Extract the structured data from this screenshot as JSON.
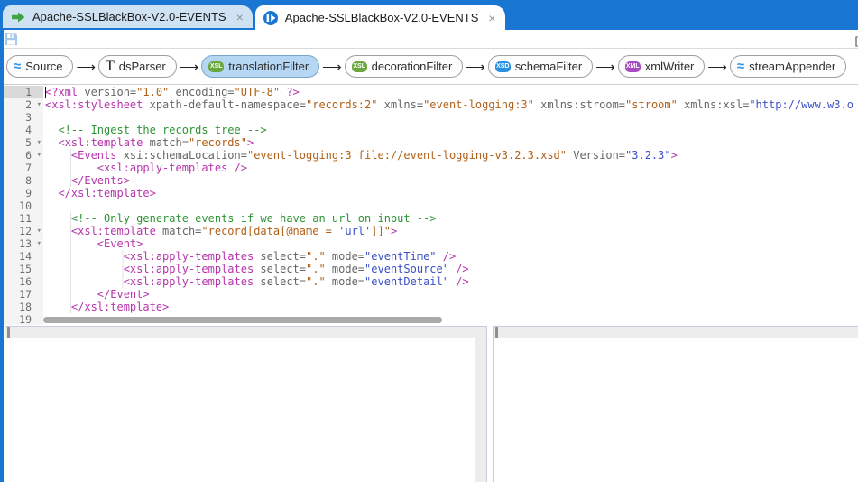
{
  "window": {
    "corner_text": "[-"
  },
  "colors": {
    "titlebar": "#1976d2",
    "tab_inactive_bg": "#cfe2f4",
    "selected_chip_bg": "#b5d7f3",
    "wave_icon": "#2b95e8",
    "xsl_badge": "#6aa83f",
    "xsd_badge": "#2b90e0",
    "xml_badge": "#a94bc0",
    "code_tag": "#b734ad",
    "code_attr": "#666666",
    "code_val": "#b06018",
    "code_str": "#3b50c8",
    "code_comment": "#2f9335"
  },
  "tabs": [
    {
      "label": "Apache-SSLBlackBox-V2.0-EVENTS",
      "icon": "pipeline-arrow-icon",
      "close_glyph": "×",
      "active": false
    },
    {
      "label": "Apache-SSLBlackBox-V2.0-EVENTS",
      "icon": "xslt-doc-icon",
      "close_glyph": "×",
      "active": true
    }
  ],
  "toolbar": {
    "save_icon": "save-icon"
  },
  "pipeline": {
    "arrow_glyph": "⟶",
    "icon_badges": {
      "xsl": "XSL",
      "xsd": "XSD",
      "xml": "XML",
      "stream": "≈",
      "text": "T"
    },
    "elements": [
      {
        "label": "Source",
        "icon": "stream",
        "selected": false
      },
      {
        "label": "dsParser",
        "icon": "text",
        "selected": false
      },
      {
        "label": "translationFilter",
        "icon": "xsl",
        "selected": true
      },
      {
        "label": "decorationFilter",
        "icon": "xsl",
        "selected": false
      },
      {
        "label": "schemaFilter",
        "icon": "xsd",
        "selected": false
      },
      {
        "label": "xmlWriter",
        "icon": "xml",
        "selected": false
      },
      {
        "label": "streamAppender",
        "icon": "stream",
        "selected": false
      }
    ]
  },
  "editor": {
    "active_line": 1,
    "fold_glyph": "▾",
    "folded_lines": [
      2,
      5,
      6,
      12,
      13
    ],
    "lines": [
      {
        "n": 1,
        "seg": [
          [
            "tag",
            "<?xml"
          ],
          [
            "attr",
            " version="
          ],
          [
            "val",
            "\"1.0\""
          ],
          [
            "attr",
            " encoding="
          ],
          [
            "val",
            "\"UTF-8\""
          ],
          [
            "tag",
            " ?>"
          ]
        ]
      },
      {
        "n": 2,
        "seg": [
          [
            "tag",
            "<xsl:stylesheet"
          ],
          [
            "attr",
            " xpath-default-namespace="
          ],
          [
            "val",
            "\"records:2\""
          ],
          [
            "attr",
            " xmlns="
          ],
          [
            "val",
            "\"event-logging:3\""
          ],
          [
            "attr",
            " xmlns:stroom="
          ],
          [
            "val",
            "\"stroom\""
          ],
          [
            "attr",
            " xmlns:xsl="
          ],
          [
            "str",
            "\"http://www.w3.o"
          ]
        ]
      },
      {
        "n": 3,
        "seg": []
      },
      {
        "n": 4,
        "seg": [
          [
            "ws",
            "  "
          ],
          [
            "com",
            "<!-- Ingest the records tree -->"
          ]
        ]
      },
      {
        "n": 5,
        "seg": [
          [
            "ws",
            "  "
          ],
          [
            "tag",
            "<xsl:template"
          ],
          [
            "attr",
            " match="
          ],
          [
            "val",
            "\"records\""
          ],
          [
            "tag",
            ">"
          ]
        ]
      },
      {
        "n": 6,
        "seg": [
          [
            "ws",
            "    "
          ],
          [
            "tag",
            "<Events"
          ],
          [
            "attr",
            " xsi:schemaLocation="
          ],
          [
            "val",
            "\"event-logging:3 file://event-logging-v3.2.3.xsd\""
          ],
          [
            "attr",
            " Version="
          ],
          [
            "str",
            "\"3.2.3\""
          ],
          [
            "tag",
            ">"
          ]
        ]
      },
      {
        "n": 7,
        "seg": [
          [
            "ws",
            "        "
          ],
          [
            "tag",
            "<xsl:apply-templates />"
          ]
        ]
      },
      {
        "n": 8,
        "seg": [
          [
            "ws",
            "    "
          ],
          [
            "tag",
            "</Events>"
          ]
        ]
      },
      {
        "n": 9,
        "seg": [
          [
            "ws",
            "  "
          ],
          [
            "tag",
            "</xsl:template>"
          ]
        ]
      },
      {
        "n": 10,
        "seg": []
      },
      {
        "n": 11,
        "seg": [
          [
            "ws",
            "    "
          ],
          [
            "com",
            "<!-- Only generate events if we have an url on input -->"
          ]
        ]
      },
      {
        "n": 12,
        "seg": [
          [
            "ws",
            "    "
          ],
          [
            "tag",
            "<xsl:template"
          ],
          [
            "attr",
            " match="
          ],
          [
            "val",
            "\"record[data[@name = "
          ],
          [
            "str",
            "'url'"
          ],
          [
            "val",
            "]]\""
          ],
          [
            "tag",
            ">"
          ]
        ]
      },
      {
        "n": 13,
        "seg": [
          [
            "ws",
            "        "
          ],
          [
            "tag",
            "<Event>"
          ]
        ]
      },
      {
        "n": 14,
        "seg": [
          [
            "ws",
            "            "
          ],
          [
            "tag",
            "<xsl:apply-templates"
          ],
          [
            "attr",
            " select="
          ],
          [
            "val",
            "\".\""
          ],
          [
            "attr",
            " mode="
          ],
          [
            "str",
            "\"eventTime\""
          ],
          [
            "tag",
            " />"
          ]
        ]
      },
      {
        "n": 15,
        "seg": [
          [
            "ws",
            "            "
          ],
          [
            "tag",
            "<xsl:apply-templates"
          ],
          [
            "attr",
            " select="
          ],
          [
            "val",
            "\".\""
          ],
          [
            "attr",
            " mode="
          ],
          [
            "str",
            "\"eventSource\""
          ],
          [
            "tag",
            " />"
          ]
        ]
      },
      {
        "n": 16,
        "seg": [
          [
            "ws",
            "            "
          ],
          [
            "tag",
            "<xsl:apply-templates"
          ],
          [
            "attr",
            " select="
          ],
          [
            "val",
            "\".\""
          ],
          [
            "attr",
            " mode="
          ],
          [
            "str",
            "\"eventDetail\""
          ],
          [
            "tag",
            " />"
          ]
        ]
      },
      {
        "n": 17,
        "seg": [
          [
            "ws",
            "        "
          ],
          [
            "tag",
            "</Event>"
          ]
        ]
      },
      {
        "n": 18,
        "seg": [
          [
            "ws",
            "    "
          ],
          [
            "tag",
            "</xsl:template>"
          ]
        ]
      },
      {
        "n": 19,
        "seg": []
      }
    ]
  }
}
